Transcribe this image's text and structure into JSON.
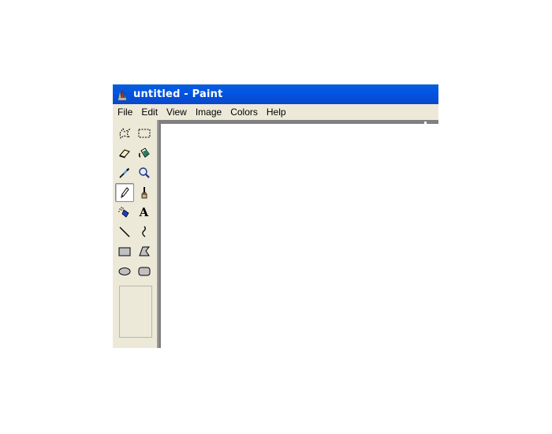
{
  "window": {
    "title": "untitled - Paint"
  },
  "menu": {
    "items": [
      "File",
      "Edit",
      "View",
      "Image",
      "Colors",
      "Help"
    ]
  },
  "toolbox": {
    "tools": [
      {
        "name": "free-form-select",
        "icon": "free-form-select-icon"
      },
      {
        "name": "select",
        "icon": "rectangle-select-icon"
      },
      {
        "name": "eraser",
        "icon": "eraser-icon"
      },
      {
        "name": "fill-with-color",
        "icon": "paint-bucket-icon"
      },
      {
        "name": "pick-color",
        "icon": "eyedropper-icon"
      },
      {
        "name": "magnifier",
        "icon": "magnifier-icon"
      },
      {
        "name": "pencil",
        "icon": "pencil-icon",
        "selected": true
      },
      {
        "name": "brush",
        "icon": "brush-icon"
      },
      {
        "name": "airbrush",
        "icon": "airbrush-icon"
      },
      {
        "name": "text",
        "icon": "text-icon",
        "glyph": "A"
      },
      {
        "name": "line",
        "icon": "line-icon"
      },
      {
        "name": "curve",
        "icon": "curve-icon"
      },
      {
        "name": "rectangle",
        "icon": "rectangle-icon"
      },
      {
        "name": "polygon",
        "icon": "polygon-icon"
      },
      {
        "name": "ellipse",
        "icon": "ellipse-icon"
      },
      {
        "name": "rounded-rectangle",
        "icon": "rounded-rectangle-icon"
      }
    ]
  },
  "colors": {
    "title_bar": "#0055e5",
    "chrome": "#ece9d8",
    "canvas": "#ffffff"
  }
}
